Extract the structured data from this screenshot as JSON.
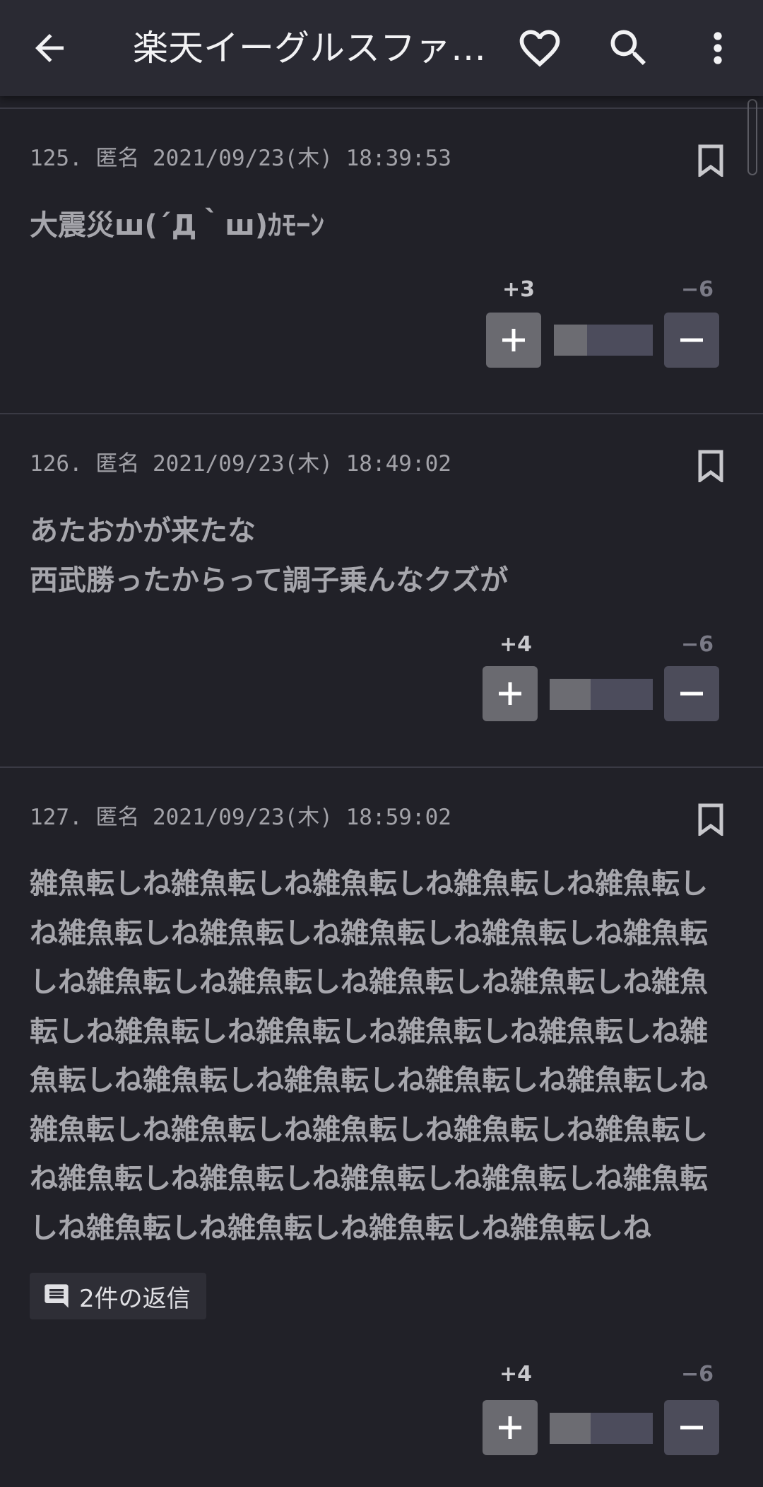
{
  "header": {
    "title": "楽天イーグルスファ…",
    "back_icon": "arrow-back-icon",
    "favorite_icon": "heart-outline-icon",
    "search_icon": "search-icon",
    "menu_icon": "more-vert-icon"
  },
  "posts": [
    {
      "meta": "125.  匿名  2021/09/23(木) 18:39:53",
      "body": [
        "大震災ш(´Д｀ш)ｶﾓｰﾝ"
      ],
      "plus_label": "+3",
      "minus_label": "−6",
      "plus": 3,
      "minus": 6
    },
    {
      "meta": "126.  匿名  2021/09/23(木) 18:49:02",
      "body": [
        "あたおかが来たな",
        "西武勝ったからって調子乗んなクズが"
      ],
      "plus_label": "+4",
      "minus_label": "−6",
      "plus": 4,
      "minus": 6
    },
    {
      "meta": "127.  匿名  2021/09/23(木) 18:59:02",
      "body": [
        "雑魚転しね雑魚転しね雑魚転しね雑魚転しね雑魚転しね雑魚転しね雑魚転しね雑魚転しね雑魚転しね雑魚転しね雑魚転しね雑魚転しね雑魚転しね雑魚転しね雑魚転しね雑魚転しね雑魚転しね雑魚転しね雑魚転しね雑魚転しね雑魚転しね雑魚転しね雑魚転しね雑魚転しね雑魚転しね雑魚転しね雑魚転しね雑魚転しね雑魚転しね雑魚転しね雑魚転しね雑魚転しね雑魚転しね雑魚転しね雑魚転しね雑魚転しね雑魚転しね雑魚転しね"
      ],
      "replies_label": "2件の返信",
      "plus_label": "+4",
      "minus_label": "−6",
      "plus": 4,
      "minus": 6
    }
  ],
  "colors": {
    "background": "#212128",
    "appbar": "#2a2a33",
    "plus_button": "#6a6a70",
    "minus_button": "#4c4c5a"
  }
}
